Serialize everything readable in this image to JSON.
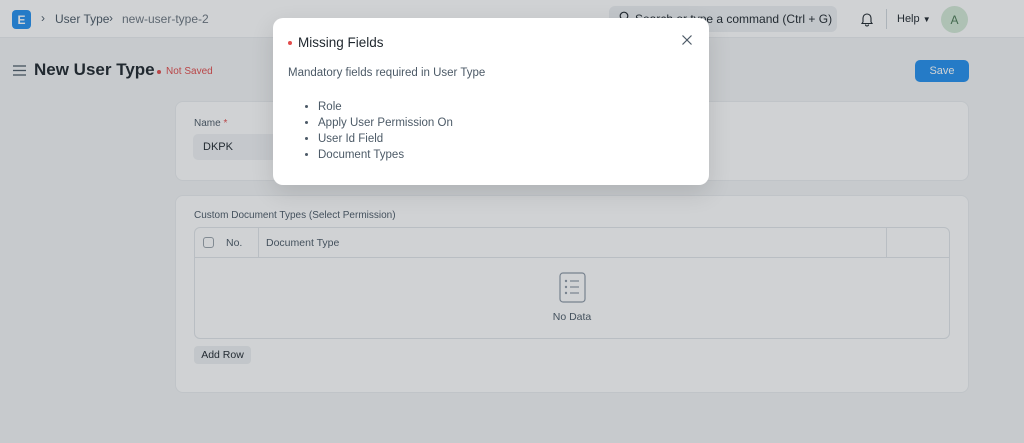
{
  "navbar": {
    "logo_letter": "E",
    "breadcrumbs": [
      "User Type",
      "new-user-type-2"
    ],
    "search_placeholder": "Search or type a command (Ctrl + G)",
    "help_label": "Help",
    "avatar_initial": "A"
  },
  "page": {
    "title": "New User Type",
    "status": "Not Saved",
    "save_label": "Save"
  },
  "form": {
    "name_label": "Name",
    "required_mark": "*",
    "name_value": "DKPK",
    "section_label": "Custom Document Types (Select Permission)",
    "table": {
      "columns": [
        "No.",
        "Document Type"
      ],
      "empty_text": "No Data"
    },
    "add_row_label": "Add Row"
  },
  "modal": {
    "title": "Missing Fields",
    "message": "Mandatory fields required in User Type",
    "fields": [
      "Role",
      "Apply User Permission On",
      "User Id Field",
      "Document Types"
    ]
  },
  "colors": {
    "primary": "#2490ef",
    "danger": "#e24c4c",
    "overlay": "rgba(40,50,60,0.22)"
  }
}
